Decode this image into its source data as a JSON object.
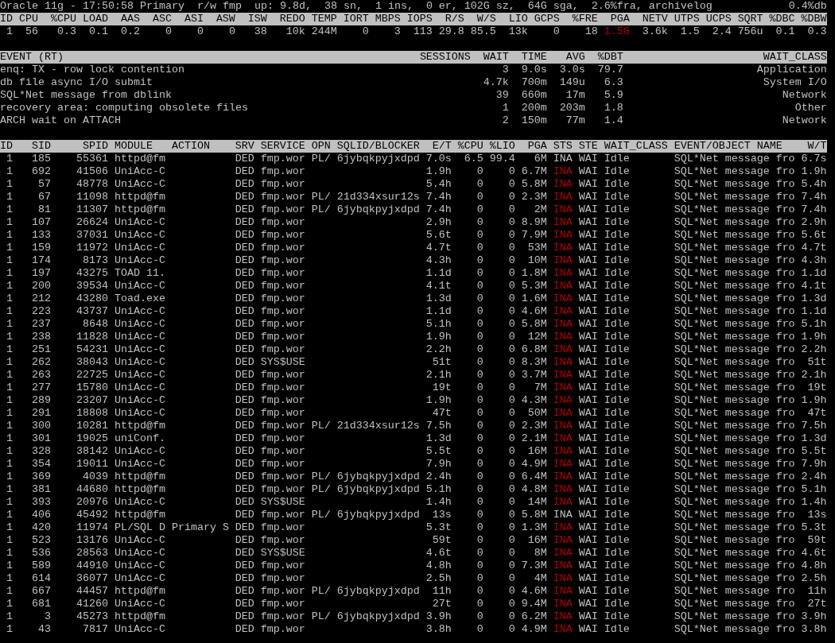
{
  "status_line": {
    "text": "Oracle 11g - 17:50:58 Primary  r/w fmp  up: 9.8d,  38 sn,  1 ins,  0 er, 102G sz,  64G sga,  2.6%fra, archivelog",
    "db_load": "0.4%db"
  },
  "instance": {
    "columns": [
      "ID",
      "CPU",
      "%CPU",
      "LOAD",
      "AAS",
      "ASC",
      "ASI",
      "ASW",
      "ISW",
      "REDO",
      "TEMP",
      "IORT",
      "MBPS",
      "IOPS",
      "R/S",
      "W/S",
      "LIO",
      "GCPS",
      "%FRE",
      "PGA",
      "NETV",
      "UTPS",
      "UCPS",
      "SQRT",
      "%DBC",
      "%DBW"
    ],
    "values": [
      {
        "text": "1",
        "alert": false
      },
      {
        "text": "56",
        "alert": false
      },
      {
        "text": "0.3",
        "alert": false
      },
      {
        "text": "0.1",
        "alert": false
      },
      {
        "text": "0.2",
        "alert": false
      },
      {
        "text": "0",
        "alert": false
      },
      {
        "text": "0",
        "alert": false
      },
      {
        "text": "0",
        "alert": false
      },
      {
        "text": "38",
        "alert": false
      },
      {
        "text": "10k",
        "alert": false
      },
      {
        "text": "244M",
        "alert": false
      },
      {
        "text": "0",
        "alert": false
      },
      {
        "text": "3",
        "alert": false
      },
      {
        "text": "113",
        "alert": false
      },
      {
        "text": "29.8",
        "alert": false
      },
      {
        "text": "85.5",
        "alert": false
      },
      {
        "text": "13k",
        "alert": false
      },
      {
        "text": "0",
        "alert": false
      },
      {
        "text": "18",
        "alert": false
      },
      {
        "text": "1.5G",
        "alert": true
      },
      {
        "text": "3.6k",
        "alert": false
      },
      {
        "text": "1.5",
        "alert": false
      },
      {
        "text": "2.4",
        "alert": false
      },
      {
        "text": "756u",
        "alert": false
      },
      {
        "text": "0.1",
        "alert": false
      },
      {
        "text": "0.3",
        "alert": false
      }
    ]
  },
  "events": {
    "columns": [
      "EVENT (RT)",
      "SESSIONS",
      "WAIT",
      "TIME",
      "AVG",
      "%DBT",
      "WAIT_CLASS"
    ],
    "rows": [
      {
        "name": "enq: TX - row lock contention",
        "wait": "3",
        "time": "9.0s",
        "avg": "3.0s",
        "dbt": "79.7",
        "wait_class": "Application"
      },
      {
        "name": "db file async I/O submit",
        "wait": "4.7k",
        "time": "700m",
        "avg": "149u",
        "dbt": "6.3",
        "wait_class": "System I/O"
      },
      {
        "name": "SQL*Net message from dblink",
        "wait": "39",
        "time": "660m",
        "avg": "17m",
        "dbt": "5.9",
        "wait_class": "Network"
      },
      {
        "name": "recovery area: computing obsolete files",
        "wait": "1",
        "time": "200m",
        "avg": "203m",
        "dbt": "1.8",
        "wait_class": "Other"
      },
      {
        "name": "ARCH wait on ATTACH",
        "wait": "2",
        "time": "150m",
        "avg": "77m",
        "dbt": "1.4",
        "wait_class": "Network"
      }
    ]
  },
  "sessions": {
    "columns": [
      "ID",
      "SID",
      "SPID",
      "MODULE",
      "ACTION",
      "SRV",
      "SERVICE",
      "OPN",
      "SQLID/BLOCKER",
      "E/T",
      "%CPU",
      "%LIO",
      "PGA",
      "STS",
      "STE",
      "WAIT_CLASS",
      "EVENT/OBJECT NAME",
      "W/T"
    ],
    "rows": [
      {
        "id": "1",
        "sid": "185",
        "spid": "55361",
        "module": "httpd@fm",
        "srv": "DED",
        "service": "fmp.wor",
        "opn": "PL/",
        "sqlid": "6jybqkpyjxdpd",
        "et": "7.0s",
        "cpu": "6.5",
        "lio": "99.4",
        "pga": "6M",
        "sts": "INA",
        "sts_alert": false,
        "ste": "WAI",
        "wait_class": "Idle",
        "event": "SQL*Net message fro",
        "wt": "6.7s"
      },
      {
        "id": "1",
        "sid": "692",
        "spid": "41506",
        "module": "UniAcc-C",
        "srv": "DED",
        "service": "fmp.wor",
        "et": "1.9h",
        "cpu": "0",
        "lio": "0",
        "pga": "6.7M",
        "sts": "INA",
        "sts_alert": true,
        "ste": "WAI",
        "wait_class": "Idle",
        "event": "SQL*Net message fro",
        "wt": "1.9h"
      },
      {
        "id": "1",
        "sid": "57",
        "spid": "48778",
        "module": "UniAcc-C",
        "srv": "DED",
        "service": "fmp.wor",
        "et": "5.4h",
        "cpu": "0",
        "lio": "0",
        "pga": "5.8M",
        "sts": "INA",
        "sts_alert": true,
        "ste": "WAI",
        "wait_class": "Idle",
        "event": "SQL*Net message fro",
        "wt": "5.4h"
      },
      {
        "id": "1",
        "sid": "67",
        "spid": "11098",
        "module": "httpd@fm",
        "srv": "DED",
        "service": "fmp.wor",
        "opn": "PL/",
        "sqlid": "21d334xsur12s",
        "et": "7.4h",
        "cpu": "0",
        "lio": "0",
        "pga": "2.3M",
        "sts": "INA",
        "sts_alert": true,
        "ste": "WAI",
        "wait_class": "Idle",
        "event": "SQL*Net message fro",
        "wt": "7.4h"
      },
      {
        "id": "1",
        "sid": "81",
        "spid": "11307",
        "module": "httpd@fm",
        "srv": "DED",
        "service": "fmp.wor",
        "opn": "PL/",
        "sqlid": "6jybqkpyjxdpd",
        "et": "7.4h",
        "cpu": "0",
        "lio": "0",
        "pga": "2M",
        "sts": "INA",
        "sts_alert": true,
        "ste": "WAI",
        "wait_class": "Idle",
        "event": "SQL*Net message fro",
        "wt": "7.4h"
      },
      {
        "id": "1",
        "sid": "107",
        "spid": "26624",
        "module": "UniAcc-C",
        "srv": "DED",
        "service": "fmp.wor",
        "et": "2.9h",
        "cpu": "0",
        "lio": "0",
        "pga": "8.9M",
        "sts": "INA",
        "sts_alert": true,
        "ste": "WAI",
        "wait_class": "Idle",
        "event": "SQL*Net message fro",
        "wt": "2.9h"
      },
      {
        "id": "1",
        "sid": "133",
        "spid": "37031",
        "module": "UniAcc-C",
        "srv": "DED",
        "service": "fmp.wor",
        "et": "5.6t",
        "cpu": "0",
        "lio": "0",
        "pga": "7.9M",
        "sts": "INA",
        "sts_alert": true,
        "ste": "WAI",
        "wait_class": "Idle",
        "event": "SQL*Net message fro",
        "wt": "5.6t"
      },
      {
        "id": "1",
        "sid": "159",
        "spid": "11972",
        "module": "UniAcc-C",
        "srv": "DED",
        "service": "fmp.wor",
        "et": "4.7t",
        "cpu": "0",
        "lio": "0",
        "pga": "53M",
        "sts": "INA",
        "sts_alert": true,
        "ste": "WAI",
        "wait_class": "Idle",
        "event": "SQL*Net message fro",
        "wt": "4.7t"
      },
      {
        "id": "1",
        "sid": "174",
        "spid": "8173",
        "module": "UniAcc-C",
        "srv": "DED",
        "service": "fmp.wor",
        "et": "4.3h",
        "cpu": "0",
        "lio": "0",
        "pga": "10M",
        "sts": "INA",
        "sts_alert": true,
        "ste": "WAI",
        "wait_class": "Idle",
        "event": "SQL*Net message fro",
        "wt": "4.3h"
      },
      {
        "id": "1",
        "sid": "197",
        "spid": "43275",
        "module": "TOAD 11.",
        "srv": "DED",
        "service": "fmp.wor",
        "et": "1.1d",
        "cpu": "0",
        "lio": "0",
        "pga": "1.8M",
        "sts": "INA",
        "sts_alert": true,
        "ste": "WAI",
        "wait_class": "Idle",
        "event": "SQL*Net message fro",
        "wt": "1.1d"
      },
      {
        "id": "1",
        "sid": "200",
        "spid": "39534",
        "module": "UniAcc-C",
        "srv": "DED",
        "service": "fmp.wor",
        "et": "4.1t",
        "cpu": "0",
        "lio": "0",
        "pga": "5.3M",
        "sts": "INA",
        "sts_alert": true,
        "ste": "WAI",
        "wait_class": "Idle",
        "event": "SQL*Net message fro",
        "wt": "4.1t"
      },
      {
        "id": "1",
        "sid": "212",
        "spid": "43280",
        "module": "Toad.exe",
        "srv": "DED",
        "service": "fmp.wor",
        "et": "1.3d",
        "cpu": "0",
        "lio": "0",
        "pga": "1.6M",
        "sts": "INA",
        "sts_alert": true,
        "ste": "WAI",
        "wait_class": "Idle",
        "event": "SQL*Net message fro",
        "wt": "1.3d"
      },
      {
        "id": "1",
        "sid": "223",
        "spid": "43737",
        "module": "UniAcc-C",
        "srv": "DED",
        "service": "fmp.wor",
        "et": "1.1d",
        "cpu": "0",
        "lio": "0",
        "pga": "4.6M",
        "sts": "INA",
        "sts_alert": true,
        "ste": "WAI",
        "wait_class": "Idle",
        "event": "SQL*Net message fro",
        "wt": "1.1d"
      },
      {
        "id": "1",
        "sid": "237",
        "spid": "8648",
        "module": "UniAcc-C",
        "srv": "DED",
        "service": "fmp.wor",
        "et": "5.1h",
        "cpu": "0",
        "lio": "0",
        "pga": "5.8M",
        "sts": "INA",
        "sts_alert": true,
        "ste": "WAI",
        "wait_class": "Idle",
        "event": "SQL*Net message fro",
        "wt": "5.1h"
      },
      {
        "id": "1",
        "sid": "238",
        "spid": "11828",
        "module": "UniAcc-C",
        "srv": "DED",
        "service": "fmp.wor",
        "et": "1.9h",
        "cpu": "0",
        "lio": "0",
        "pga": "12M",
        "sts": "INA",
        "sts_alert": true,
        "ste": "WAI",
        "wait_class": "Idle",
        "event": "SQL*Net message fro",
        "wt": "1.9h"
      },
      {
        "id": "1",
        "sid": "251",
        "spid": "54231",
        "module": "UniAcc-C",
        "srv": "DED",
        "service": "fmp.wor",
        "et": "2.2h",
        "cpu": "0",
        "lio": "0",
        "pga": "6.8M",
        "sts": "INA",
        "sts_alert": true,
        "ste": "WAI",
        "wait_class": "Idle",
        "event": "SQL*Net message fro",
        "wt": "2.2h"
      },
      {
        "id": "1",
        "sid": "262",
        "spid": "38043",
        "module": "UniAcc-C",
        "srv": "DED",
        "service": "SYS$USE",
        "et": "51t",
        "cpu": "0",
        "lio": "0",
        "pga": "8.3M",
        "sts": "INA",
        "sts_alert": true,
        "ste": "WAI",
        "wait_class": "Idle",
        "event": "SQL*Net message fro",
        "wt": "51t"
      },
      {
        "id": "1",
        "sid": "263",
        "spid": "22725",
        "module": "UniAcc-C",
        "srv": "DED",
        "service": "fmp.wor",
        "et": "2.1h",
        "cpu": "0",
        "lio": "0",
        "pga": "3.7M",
        "sts": "INA",
        "sts_alert": true,
        "ste": "WAI",
        "wait_class": "Idle",
        "event": "SQL*Net message fro",
        "wt": "2.1h"
      },
      {
        "id": "1",
        "sid": "277",
        "spid": "15780",
        "module": "UniAcc-C",
        "srv": "DED",
        "service": "fmp.wor",
        "et": "19t",
        "cpu": "0",
        "lio": "0",
        "pga": "7M",
        "sts": "INA",
        "sts_alert": true,
        "ste": "WAI",
        "wait_class": "Idle",
        "event": "SQL*Net message fro",
        "wt": "19t"
      },
      {
        "id": "1",
        "sid": "289",
        "spid": "23207",
        "module": "UniAcc-C",
        "srv": "DED",
        "service": "fmp.wor",
        "et": "1.9h",
        "cpu": "0",
        "lio": "0",
        "pga": "4.3M",
        "sts": "INA",
        "sts_alert": true,
        "ste": "WAI",
        "wait_class": "Idle",
        "event": "SQL*Net message fro",
        "wt": "1.9h"
      },
      {
        "id": "1",
        "sid": "291",
        "spid": "18808",
        "module": "UniAcc-C",
        "srv": "DED",
        "service": "fmp.wor",
        "et": "47t",
        "cpu": "0",
        "lio": "0",
        "pga": "50M",
        "sts": "INA",
        "sts_alert": true,
        "ste": "WAI",
        "wait_class": "Idle",
        "event": "SQL*Net message fro",
        "wt": "47t"
      },
      {
        "id": "1",
        "sid": "300",
        "spid": "10281",
        "module": "httpd@fm",
        "srv": "DED",
        "service": "fmp.wor",
        "opn": "PL/",
        "sqlid": "21d334xsur12s",
        "et": "7.5h",
        "cpu": "0",
        "lio": "0",
        "pga": "2.3M",
        "sts": "INA",
        "sts_alert": true,
        "ste": "WAI",
        "wait_class": "Idle",
        "event": "SQL*Net message fro",
        "wt": "7.5h"
      },
      {
        "id": "1",
        "sid": "301",
        "spid": "19025",
        "module": "uniConf.",
        "srv": "DED",
        "service": "fmp.wor",
        "et": "1.3d",
        "cpu": "0",
        "lio": "0",
        "pga": "2.1M",
        "sts": "INA",
        "sts_alert": true,
        "ste": "WAI",
        "wait_class": "Idle",
        "event": "SQL*Net message fro",
        "wt": "1.3d"
      },
      {
        "id": "1",
        "sid": "328",
        "spid": "38142",
        "module": "UniAcc-C",
        "srv": "DED",
        "service": "fmp.wor",
        "et": "5.5t",
        "cpu": "0",
        "lio": "0",
        "pga": "16M",
        "sts": "INA",
        "sts_alert": true,
        "ste": "WAI",
        "wait_class": "Idle",
        "event": "SQL*Net message fro",
        "wt": "5.5t"
      },
      {
        "id": "1",
        "sid": "354",
        "spid": "19011",
        "module": "UniAcc-C",
        "srv": "DED",
        "service": "fmp.wor",
        "et": "7.9h",
        "cpu": "0",
        "lio": "0",
        "pga": "4.9M",
        "sts": "INA",
        "sts_alert": true,
        "ste": "WAI",
        "wait_class": "Idle",
        "event": "SQL*Net message fro",
        "wt": "7.9h"
      },
      {
        "id": "1",
        "sid": "369",
        "spid": "4039",
        "module": "httpd@fm",
        "srv": "DED",
        "service": "fmp.wor",
        "opn": "PL/",
        "sqlid": "6jybqkpyjxdpd",
        "et": "2.4h",
        "cpu": "0",
        "lio": "0",
        "pga": "6.4M",
        "sts": "INA",
        "sts_alert": true,
        "ste": "WAI",
        "wait_class": "Idle",
        "event": "SQL*Net message fro",
        "wt": "2.4h"
      },
      {
        "id": "1",
        "sid": "381",
        "spid": "44680",
        "module": "httpd@fm",
        "srv": "DED",
        "service": "fmp.wor",
        "opn": "PL/",
        "sqlid": "6jybqkpyjxdpd",
        "et": "5.1h",
        "cpu": "0",
        "lio": "0",
        "pga": "4.8M",
        "sts": "INA",
        "sts_alert": true,
        "ste": "WAI",
        "wait_class": "Idle",
        "event": "SQL*Net message fro",
        "wt": "5.1h"
      },
      {
        "id": "1",
        "sid": "393",
        "spid": "20976",
        "module": "UniAcc-C",
        "srv": "DED",
        "service": "SYS$USE",
        "et": "1.4h",
        "cpu": "0",
        "lio": "0",
        "pga": "14M",
        "sts": "INA",
        "sts_alert": true,
        "ste": "WAI",
        "wait_class": "Idle",
        "event": "SQL*Net message fro",
        "wt": "1.4h"
      },
      {
        "id": "1",
        "sid": "406",
        "spid": "45492",
        "module": "httpd@fm",
        "srv": "DED",
        "service": "fmp.wor",
        "opn": "PL/",
        "sqlid": "6jybqkpyjxdpd",
        "et": "13s",
        "cpu": "0",
        "lio": "0",
        "pga": "5.8M",
        "sts": "INA",
        "sts_alert": false,
        "ste": "WAI",
        "wait_class": "Idle",
        "event": "SQL*Net message fro",
        "wt": "13s"
      },
      {
        "id": "1",
        "sid": "420",
        "spid": "11974",
        "module": "PL/SQL D",
        "action": "Primary S",
        "srv": "DED",
        "service": "fmp.wor",
        "et": "5.3t",
        "cpu": "0",
        "lio": "0",
        "pga": "1.3M",
        "sts": "INA",
        "sts_alert": true,
        "ste": "WAI",
        "wait_class": "Idle",
        "event": "SQL*Net message fro",
        "wt": "5.3t"
      },
      {
        "id": "1",
        "sid": "523",
        "spid": "13176",
        "module": "UniAcc-C",
        "srv": "DED",
        "service": "fmp.wor",
        "et": "59t",
        "cpu": "0",
        "lio": "0",
        "pga": "16M",
        "sts": "INA",
        "sts_alert": true,
        "ste": "WAI",
        "wait_class": "Idle",
        "event": "SQL*Net message fro",
        "wt": "59t"
      },
      {
        "id": "1",
        "sid": "536",
        "spid": "28563",
        "module": "UniAcc-C",
        "srv": "DED",
        "service": "SYS$USE",
        "et": "4.6t",
        "cpu": "0",
        "lio": "0",
        "pga": "8M",
        "sts": "INA",
        "sts_alert": true,
        "ste": "WAI",
        "wait_class": "Idle",
        "event": "SQL*Net message fro",
        "wt": "4.6t"
      },
      {
        "id": "1",
        "sid": "589",
        "spid": "44910",
        "module": "UniAcc-C",
        "srv": "DED",
        "service": "fmp.wor",
        "et": "4.8h",
        "cpu": "0",
        "lio": "0",
        "pga": "7.3M",
        "sts": "INA",
        "sts_alert": true,
        "ste": "WAI",
        "wait_class": "Idle",
        "event": "SQL*Net message fro",
        "wt": "4.8h"
      },
      {
        "id": "1",
        "sid": "614",
        "spid": "36077",
        "module": "UniAcc-C",
        "srv": "DED",
        "service": "fmp.wor",
        "et": "2.5h",
        "cpu": "0",
        "lio": "0",
        "pga": "4M",
        "sts": "INA",
        "sts_alert": true,
        "ste": "WAI",
        "wait_class": "Idle",
        "event": "SQL*Net message fro",
        "wt": "2.5h"
      },
      {
        "id": "1",
        "sid": "667",
        "spid": "44457",
        "module": "httpd@fm",
        "srv": "DED",
        "service": "fmp.wor",
        "opn": "PL/",
        "sqlid": "6jybqkpyjxdpd",
        "et": "11h",
        "cpu": "0",
        "lio": "0",
        "pga": "4.6M",
        "sts": "INA",
        "sts_alert": true,
        "ste": "WAI",
        "wait_class": "Idle",
        "event": "SQL*Net message fro",
        "wt": "11h"
      },
      {
        "id": "1",
        "sid": "681",
        "spid": "41260",
        "module": "UniAcc-C",
        "srv": "DED",
        "service": "fmp.wor",
        "et": "27t",
        "cpu": "0",
        "lio": "0",
        "pga": "9.4M",
        "sts": "INA",
        "sts_alert": true,
        "ste": "WAI",
        "wait_class": "Idle",
        "event": "SQL*Net message fro",
        "wt": "27t"
      },
      {
        "id": "1",
        "sid": "3",
        "spid": "45273",
        "module": "httpd@fm",
        "srv": "DED",
        "service": "fmp.wor",
        "opn": "PL/",
        "sqlid": "6jybqkpyjxdpd",
        "et": "3.9h",
        "cpu": "0",
        "lio": "0",
        "pga": "6.2M",
        "sts": "INA",
        "sts_alert": true,
        "ste": "WAI",
        "wait_class": "Idle",
        "event": "SQL*Net message fro",
        "wt": "3.9h"
      },
      {
        "id": "1",
        "sid": "43",
        "spid": "7817",
        "module": "UniAcc-C",
        "srv": "DED",
        "service": "fmp.wor",
        "et": "3.8h",
        "cpu": "0",
        "lio": "0",
        "pga": "4.9M",
        "sts": "INA",
        "sts_alert": true,
        "ste": "WAI",
        "wait_class": "Idle",
        "event": "SQL*Net message fro",
        "wt": "3.8h"
      }
    ]
  }
}
